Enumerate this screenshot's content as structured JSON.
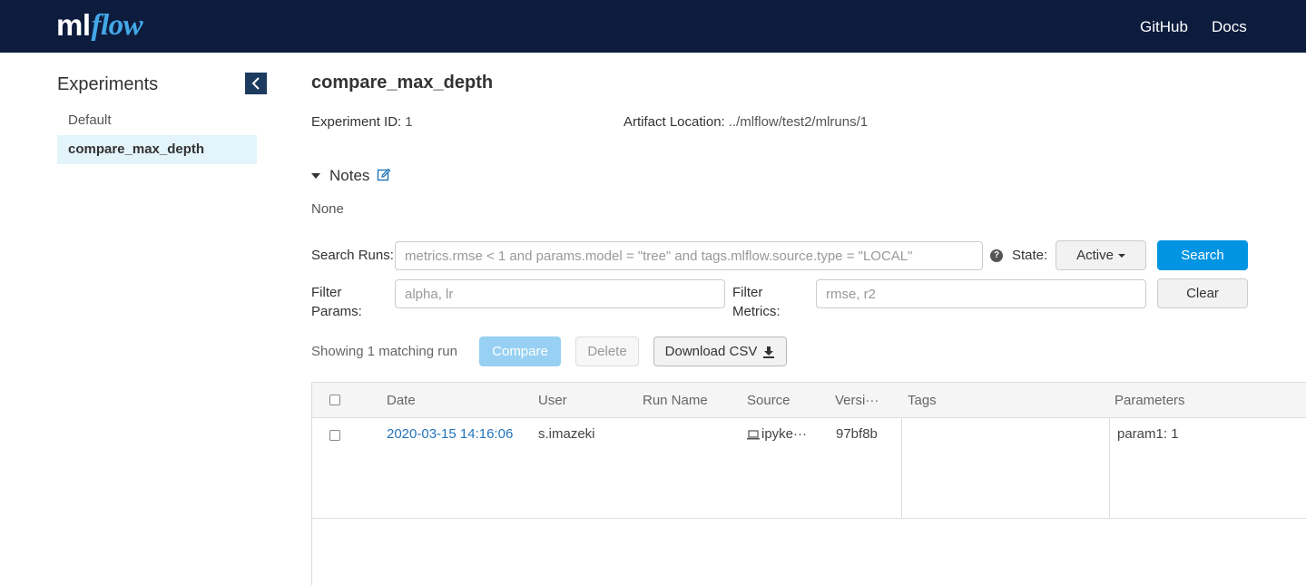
{
  "header": {
    "logo_ml": "ml",
    "logo_flow": "flow",
    "github": "GitHub",
    "docs": "Docs"
  },
  "sidebar": {
    "title": "Experiments",
    "items": [
      {
        "label": "Default"
      },
      {
        "label": "compare_max_depth",
        "active": true
      }
    ]
  },
  "experiment": {
    "title": "compare_max_depth",
    "id_label": "Experiment ID:",
    "id_value": "1",
    "artifact_label": "Artifact Location:",
    "artifact_value": "../mlflow/test2/mlruns/1"
  },
  "notes": {
    "label": "Notes",
    "content": "None"
  },
  "search": {
    "label": "Search Runs:",
    "placeholder": "metrics.rmse < 1 and params.model = \"tree\" and tags.mlflow.source.type = \"LOCAL\"",
    "filter_params_label": "Filter Params:",
    "filter_params_placeholder": "alpha, lr",
    "filter_metrics_label": "Filter Metrics:",
    "filter_metrics_placeholder": "rmse, r2",
    "state_label": "State:",
    "state_value": "Active",
    "search_button": "Search",
    "clear_button": "Clear"
  },
  "runs_toolbar": {
    "showing": "Showing 1 matching run",
    "compare": "Compare",
    "delete": "Delete",
    "download_csv": "Download CSV"
  },
  "table": {
    "columns": {
      "date": "Date",
      "user": "User",
      "run_name": "Run Name",
      "source": "Source",
      "version": "Versi···",
      "tags": "Tags",
      "parameters": "Parameters"
    },
    "rows": [
      {
        "date": "2020-03-15 14:16:06",
        "user": "s.imazeki",
        "run_name": "",
        "source": "ipyke···",
        "version": "97bf8b",
        "tags": "",
        "param": "param1: 1"
      }
    ]
  },
  "colors": {
    "header_bg": "#0d1c3d",
    "accent": "#0194e2",
    "link": "#2374bb",
    "active_item_bg": "#e3f4fb"
  }
}
